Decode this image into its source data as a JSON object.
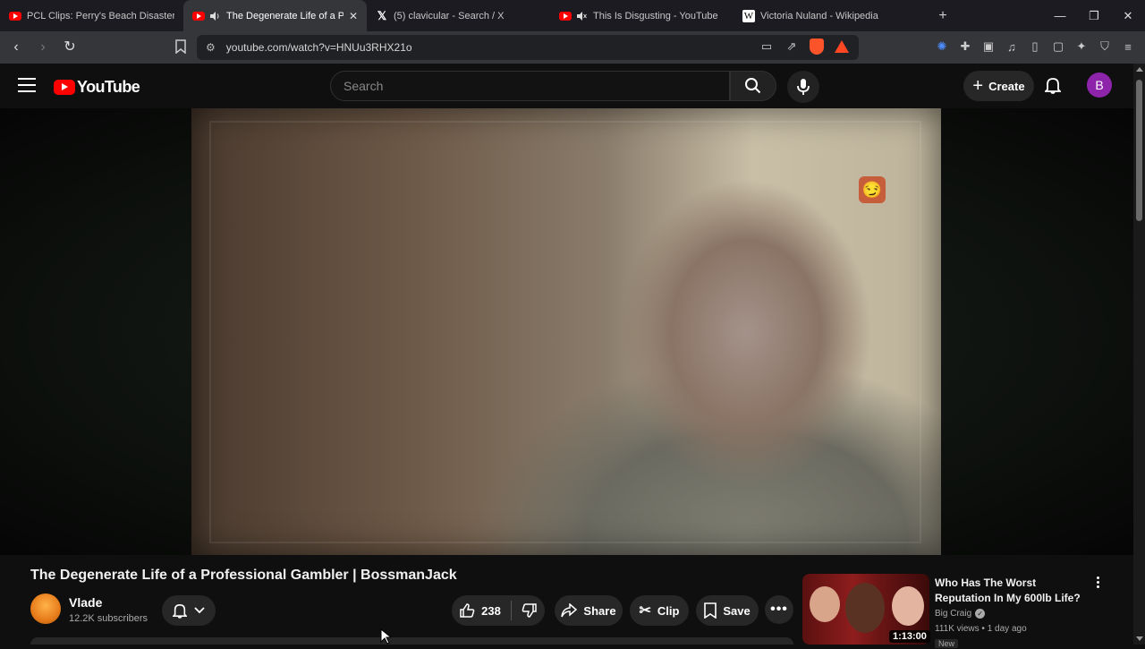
{
  "browser": {
    "tabs": [
      {
        "title": "PCL Clips: Perry's Beach Disaster - Yo",
        "icon": "youtube-icon",
        "active": false
      },
      {
        "title": "The Degenerate Life of a Prof",
        "icon": "youtube-icon",
        "active": true
      },
      {
        "title": "(5) clavicular - Search / X",
        "icon": "x-icon",
        "active": false
      },
      {
        "title": "This Is Disgusting - YouTube",
        "icon": "youtube-icon",
        "active": false
      },
      {
        "title": "Victoria Nuland - Wikipedia",
        "icon": "wikipedia-icon",
        "active": false
      }
    ],
    "url": "youtube.com/watch?v=HNUu3RHX21o"
  },
  "youtube": {
    "logo_text": "YouTube",
    "search_placeholder": "Search",
    "create_label": "Create",
    "avatar_letter": "B"
  },
  "video": {
    "title": "The Degenerate Life of a Professional Gambler | BossmanJack",
    "channel_name": "Vlade",
    "subscribers": "12.2K subscribers",
    "likes": "238",
    "share_label": "Share",
    "clip_label": "Clip",
    "save_label": "Save"
  },
  "recommended": {
    "title": "Who Has The Worst Reputation In My 600lb Life?",
    "channel": "Big Craig",
    "meta": "111K views • 1 day ago",
    "badge": "New",
    "duration": "1:13:00"
  },
  "colors": {
    "youtube_red": "#ff0000",
    "background": "#0f0f0f",
    "avatar_purple": "#8e24aa"
  }
}
